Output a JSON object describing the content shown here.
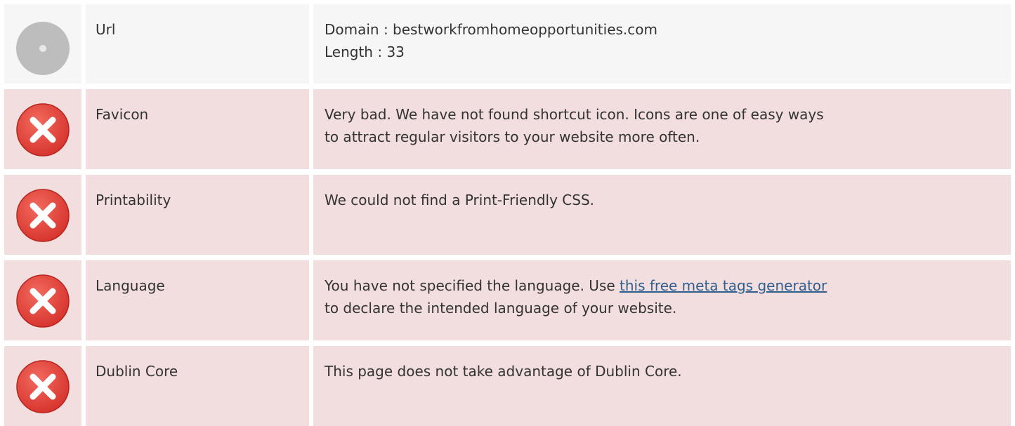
{
  "colors": {
    "neutral_row": "#f6f6f6",
    "bad_row": "#f2dede",
    "error_icon": "#e0413a",
    "neutral_icon": "#bdbdbd",
    "link": "#2f5f8f"
  },
  "rows": [
    {
      "status": "neutral",
      "icon": "neutral-circle-icon",
      "name": "Url",
      "lines": [
        "Domain : bestworkfromhomeopportunities.com",
        "Length : 33"
      ]
    },
    {
      "status": "bad",
      "icon": "error-x-icon",
      "name": "Favicon",
      "lines": [
        "Very bad. We have not found shortcut icon. Icons are one of easy ways",
        "to attract regular visitors to your website more often."
      ]
    },
    {
      "status": "bad",
      "icon": "error-x-icon",
      "name": "Printability",
      "lines": [
        "We could not find a Print-Friendly CSS."
      ]
    },
    {
      "status": "bad",
      "icon": "error-x-icon",
      "name": "Language",
      "line1_prefix": "You have not specified the language. Use ",
      "line1_link": "this free meta tags generator",
      "line2": "to declare the intended language of your website."
    },
    {
      "status": "bad",
      "icon": "error-x-icon",
      "name": "Dublin Core",
      "lines": [
        "This page does not take advantage of Dublin Core."
      ]
    }
  ]
}
